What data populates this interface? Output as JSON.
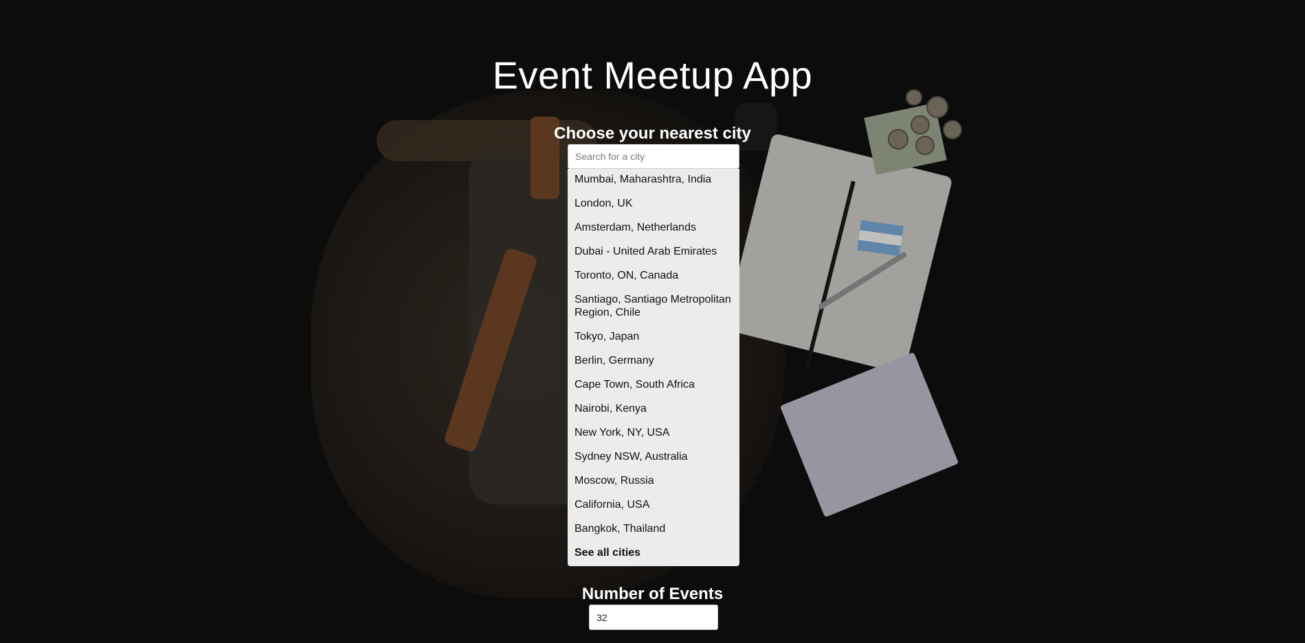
{
  "header": {
    "title": "Event Meetup App"
  },
  "city_search": {
    "label": "Choose your nearest city",
    "placeholder": "Search for a city",
    "value": "",
    "suggestions": [
      "Mumbai, Maharashtra, India",
      "London, UK",
      "Amsterdam, Netherlands",
      "Dubai - United Arab Emirates",
      "Toronto, ON, Canada",
      "Santiago, Santiago Metropolitan Region, Chile",
      "Tokyo, Japan",
      "Berlin, Germany",
      "Cape Town, South Africa",
      "Nairobi, Kenya",
      "New York, NY, USA",
      "Sydney NSW, Australia",
      "Moscow, Russia",
      "California, USA",
      "Bangkok, Thailand"
    ],
    "see_all_label": "See all cities"
  },
  "number_of_events": {
    "label": "Number of Events",
    "value": "32"
  },
  "colors": {
    "background": "#111111",
    "text_on_dark": "#ffffff",
    "suggestion_list_bg": "#ececec"
  }
}
